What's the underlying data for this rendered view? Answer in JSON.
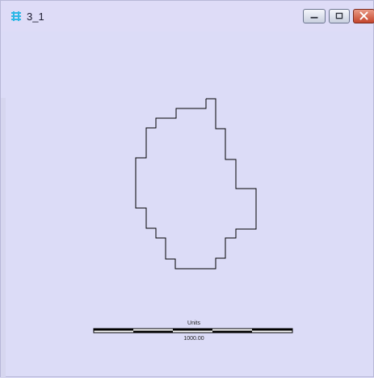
{
  "window": {
    "title": "3_1",
    "buttons": {
      "minimize": "minimize",
      "maximize": "maximize",
      "close": "close"
    }
  },
  "scale_bar": {
    "title": "Units",
    "value": "1000.00"
  },
  "colors": {
    "background": "#dcdcf7",
    "outline": "#000000",
    "close_button": "#c5452c",
    "app_icon": "#2fb8e6"
  }
}
